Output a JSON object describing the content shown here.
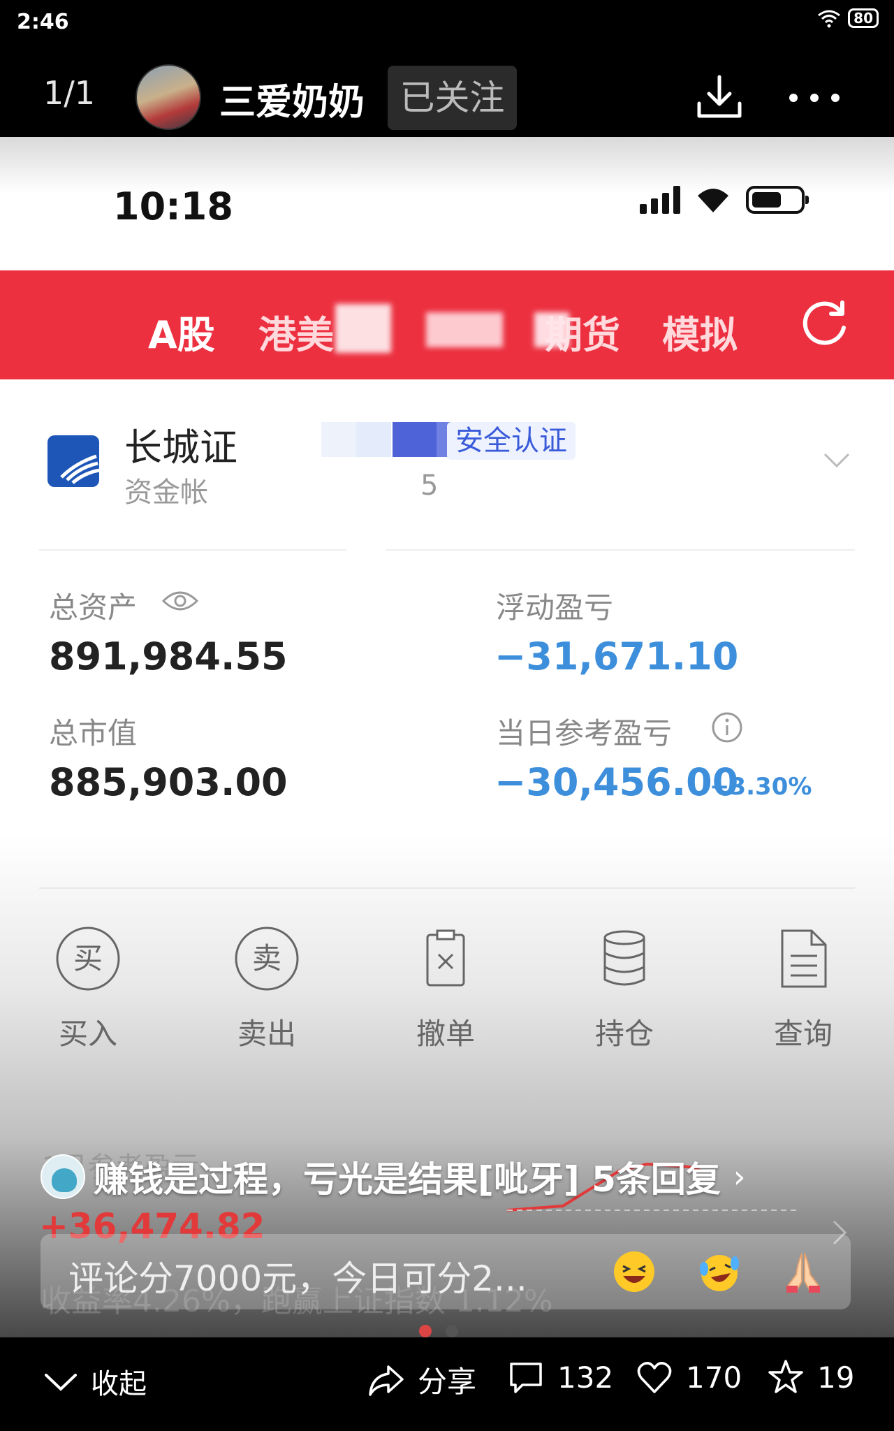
{
  "os_status": {
    "time": "2:46",
    "battery": "80"
  },
  "header": {
    "counter": "1/1",
    "author": "三爱奶奶",
    "follow_label": "已关注"
  },
  "inner_app": {
    "status_time": "10:18",
    "tabs": [
      {
        "label": "A股",
        "active": true
      },
      {
        "label": "港美",
        "active": false
      },
      {
        "label": "期货",
        "active": false
      },
      {
        "label": "模拟",
        "active": false
      }
    ],
    "broker": {
      "name": "长城证",
      "account_label": "资金帐",
      "account_tail": "5",
      "security_label": "安全认证"
    },
    "metrics": {
      "total_assets_label": "总资产",
      "total_assets": "891,984.55",
      "floating_pnl_label": "浮动盈亏",
      "floating_pnl": "−31,671.10",
      "market_value_label": "总市值",
      "market_value": "885,903.00",
      "daily_pnl_label": "当日参考盈亏",
      "daily_pnl": "−30,456.00",
      "daily_pnl_pct": "−3.30%"
    },
    "actions": [
      {
        "label": "买入",
        "icon": "buy-icon",
        "glyph": "买"
      },
      {
        "label": "卖出",
        "icon": "sell-icon",
        "glyph": "卖"
      },
      {
        "label": "撤单",
        "icon": "cancel-order-icon"
      },
      {
        "label": "持仓",
        "icon": "positions-icon"
      },
      {
        "label": "查询",
        "icon": "query-icon"
      }
    ],
    "period_pnl": {
      "label": "1月参考盈亏",
      "value": "+36,474.82",
      "rate_text": "收益率4.26%，跑赢上证指数 1.12%"
    }
  },
  "overlay": {
    "comment_text": "赚钱是过程，亏光是结果[呲牙] 5条回复",
    "comment_placeholder": "评论分7000元，今日可分2...",
    "emojis": [
      "grinning-emoji",
      "laughing-tears-emoji",
      "praying-hands-emoji"
    ]
  },
  "bottom_bar": {
    "collapse_label": "收起",
    "share_label": "分享",
    "comments": "132",
    "likes": "170",
    "favorites": "19"
  },
  "colors": {
    "brand_red": "#ec3040",
    "loss_blue": "#3d8fdb",
    "gain_red": "#e23a3a"
  }
}
